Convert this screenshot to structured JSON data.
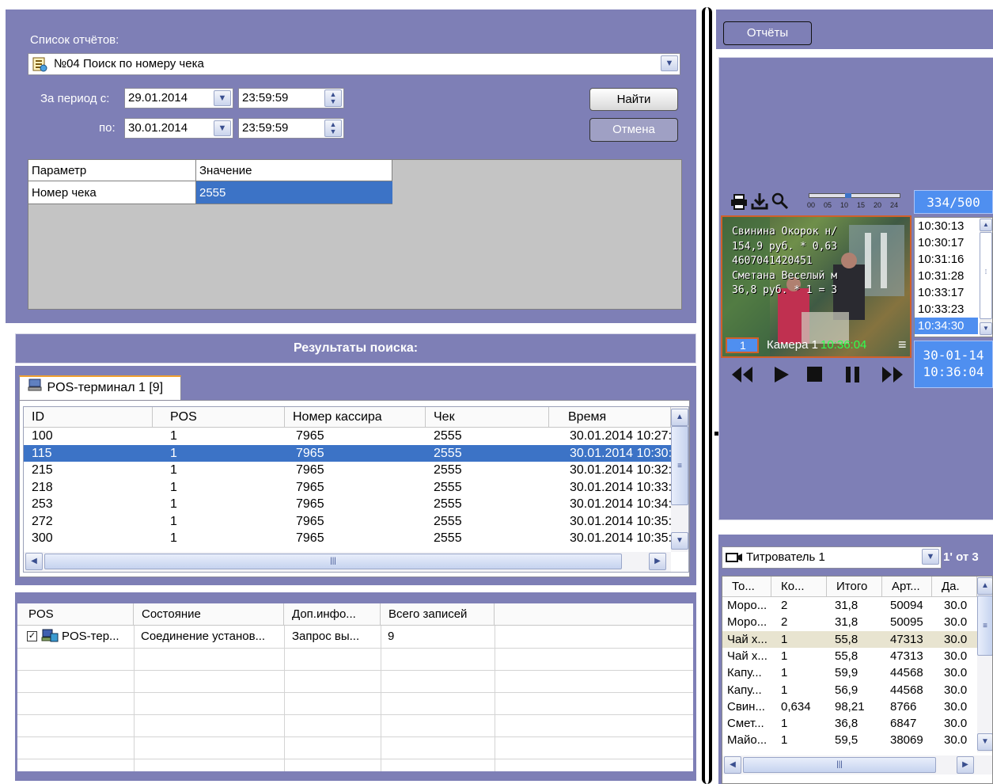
{
  "reports_panel": {
    "report_list_label": "Список отчётов:",
    "report_selected": "№04 Поиск по номеру чека",
    "period_from_label": "За период с:",
    "period_to_label": "по:",
    "date_from": "29.01.2014",
    "time_from": "23:59:59",
    "date_to": "30.01.2014",
    "time_to": "23:59:59",
    "find_button": "Найти",
    "cancel_button": "Отмена",
    "params_headers": [
      "Параметр",
      "Значение"
    ],
    "param_row": {
      "name": "Номер чека",
      "value": "2555"
    }
  },
  "results": {
    "title": "Результаты поиска:",
    "tab_label": "POS-терминал 1 [9]",
    "columns": [
      "ID",
      "POS",
      "Номер кассира",
      "Чек",
      "Время"
    ],
    "rows": [
      {
        "id": "100",
        "pos": "1",
        "cashier": "7965",
        "check": "2555",
        "time": "30.01.2014 10:27:"
      },
      {
        "id": "115",
        "pos": "1",
        "cashier": "7965",
        "check": "2555",
        "time": "30.01.2014 10:30:"
      },
      {
        "id": "215",
        "pos": "1",
        "cashier": "7965",
        "check": "2555",
        "time": "30.01.2014 10:32:"
      },
      {
        "id": "218",
        "pos": "1",
        "cashier": "7965",
        "check": "2555",
        "time": "30.01.2014 10:33:"
      },
      {
        "id": "253",
        "pos": "1",
        "cashier": "7965",
        "check": "2555",
        "time": "30.01.2014 10:34:"
      },
      {
        "id": "272",
        "pos": "1",
        "cashier": "7965",
        "check": "2555",
        "time": "30.01.2014 10:35:"
      },
      {
        "id": "300",
        "pos": "1",
        "cashier": "7965",
        "check": "2555",
        "time": "30.01.2014 10:35:"
      }
    ],
    "selected_row": 1
  },
  "pos_status": {
    "columns": [
      "POS",
      "Состояние",
      "Доп.инфо...",
      "Всего записей"
    ],
    "row": {
      "pos": "POS-тер...",
      "state": "Соединение установ...",
      "info": "Запрос вы...",
      "total": "9"
    }
  },
  "right_panel": {
    "reports_button": "Отчёты",
    "player": {
      "counter": "334/500",
      "timeline_ticks": [
        "00",
        "05",
        "10",
        "15",
        "20",
        "24"
      ],
      "times": [
        "10:30:13",
        "10:30:17",
        "10:31:16",
        "10:31:28",
        "10:33:17",
        "10:33:23",
        "10:34:30"
      ],
      "selected_time_index": 6,
      "camera_number": "1",
      "camera_label": "Камера 1",
      "camera_time": "10:36:04",
      "date_display": "30-01-14",
      "time_display": "10:36:04",
      "overlay_text": [
        "Свинина Окорок н/",
        "154,9 руб. * 0,63",
        "4607041420451",
        "Сметана Веселый м",
        "36,8 руб. * 1 = 3"
      ]
    },
    "titrator": {
      "selector": "Титрователь 1",
      "pager": "1' от 3",
      "columns": [
        "То...",
        "Ко...",
        "Итого",
        "Арт...",
        "Да."
      ],
      "rows": [
        [
          "Моро...",
          "2",
          "31,8",
          "50094",
          "30.0"
        ],
        [
          "Моро...",
          "2",
          "31,8",
          "50095",
          "30.0"
        ],
        [
          "Чай х...",
          "1",
          "55,8",
          "47313",
          "30.0"
        ],
        [
          "Чай х...",
          "1",
          "55,8",
          "47313",
          "30.0"
        ],
        [
          "Капу...",
          "1",
          "59,9",
          "44568",
          "30.0"
        ],
        [
          "Капу...",
          "1",
          "56,9",
          "44568",
          "30.0"
        ],
        [
          "Свин...",
          "0,634",
          "98,21",
          "8766",
          "30.0"
        ],
        [
          "Смет...",
          "1",
          "36,8",
          "6847",
          "30.0"
        ],
        [
          "Майо...",
          "1",
          "59,5",
          "38069",
          "30.0"
        ]
      ],
      "highlighted_row": 2
    }
  }
}
